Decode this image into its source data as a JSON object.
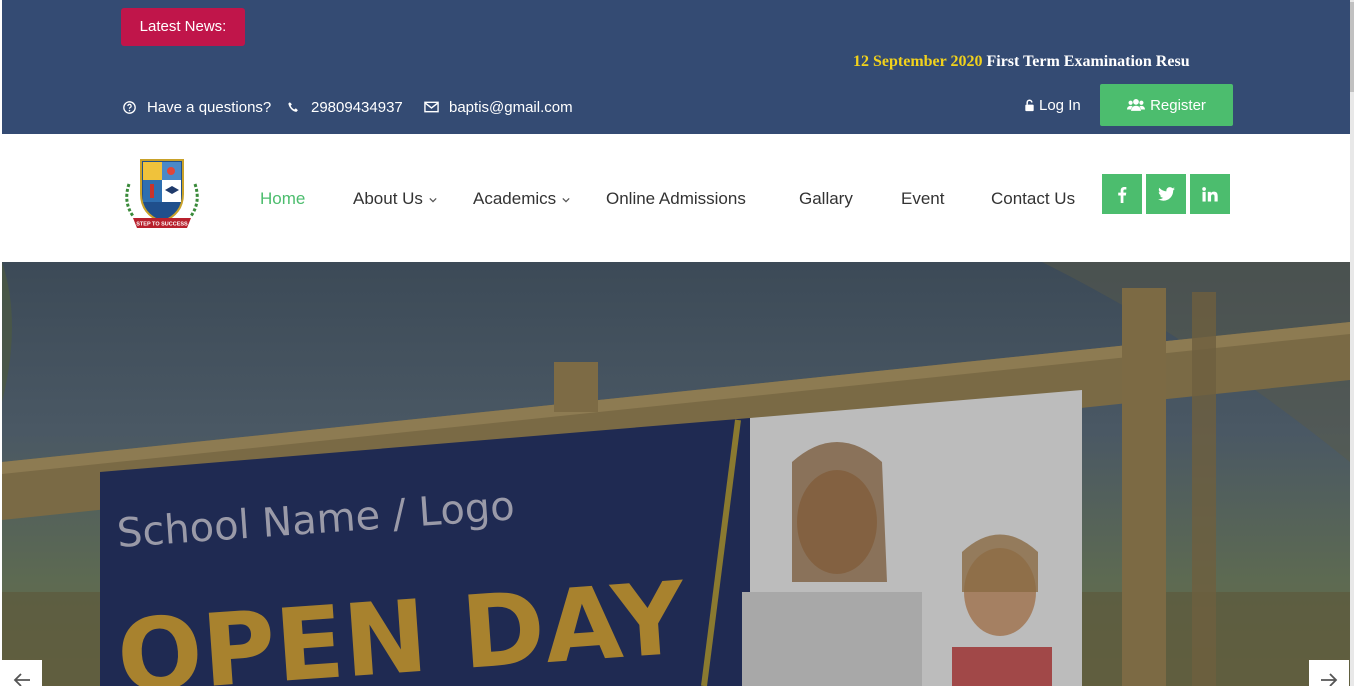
{
  "topbar": {
    "news_label": "Latest News:",
    "ticker": {
      "date": "12 September 2020",
      "text": "First Term Examination Resu"
    },
    "contacts": [
      {
        "icon": "question-circle-icon",
        "text": "Have a questions?"
      },
      {
        "icon": "phone-icon",
        "text": "29809434937"
      },
      {
        "icon": "envelope-icon",
        "text": "baptis@gmail.com"
      }
    ],
    "login_label": "Log In",
    "register_label": "Register"
  },
  "nav": {
    "logo_text": "STEP TO SUCCESS",
    "items": [
      {
        "label": "Home",
        "active": true
      },
      {
        "label": "About Us",
        "dropdown": true
      },
      {
        "label": "Academics",
        "dropdown": true
      },
      {
        "label": "Online Admissions"
      },
      {
        "label": "Gallary"
      },
      {
        "label": "Event"
      },
      {
        "label": "Contact Us"
      }
    ],
    "social": [
      "facebook-icon",
      "twitter-icon",
      "linkedin-icon"
    ]
  },
  "hero": {
    "sign_school": "School Name / Logo",
    "sign_title": "OPEN DAY"
  },
  "colors": {
    "topbar": "#344b73",
    "news_badge": "#c0154a",
    "ticker_date": "#f2d21c",
    "accent_green": "#4cbd6e"
  }
}
